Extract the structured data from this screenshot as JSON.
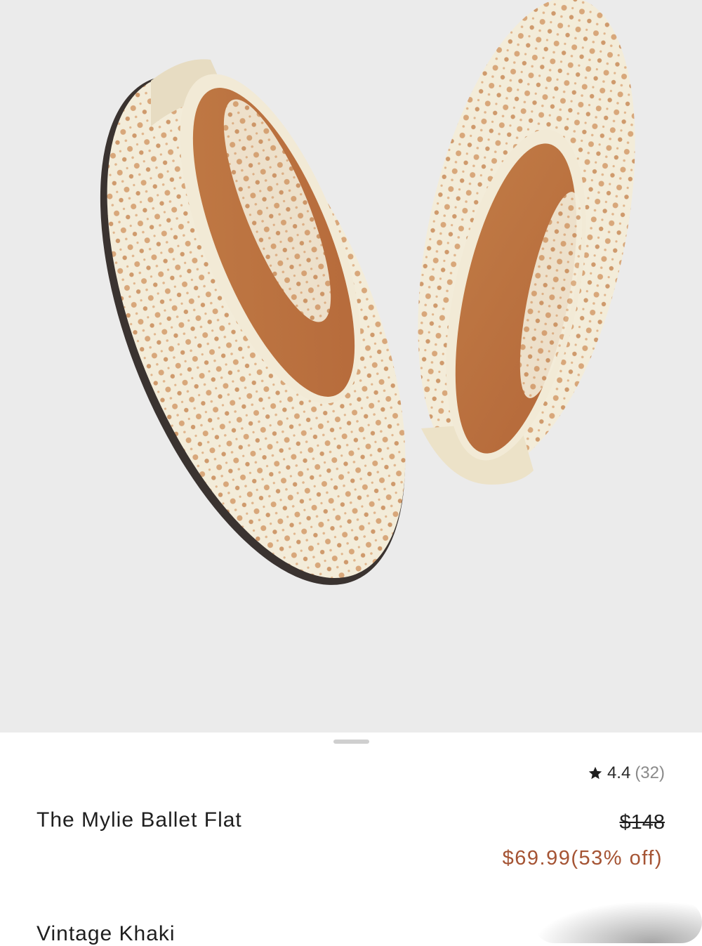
{
  "product": {
    "image_alt_icon": "product-photo",
    "rating_icon": "star-icon",
    "rating": "4.4",
    "review_count": "(32)",
    "name": "The Mylie Ballet Flat",
    "original_price": "$148",
    "sale_price": "$69.99",
    "discount": "(53% off)",
    "color": "Vintage Khaki"
  },
  "colors": {
    "background": "#ebebeb",
    "sale_price": "#a55434"
  }
}
